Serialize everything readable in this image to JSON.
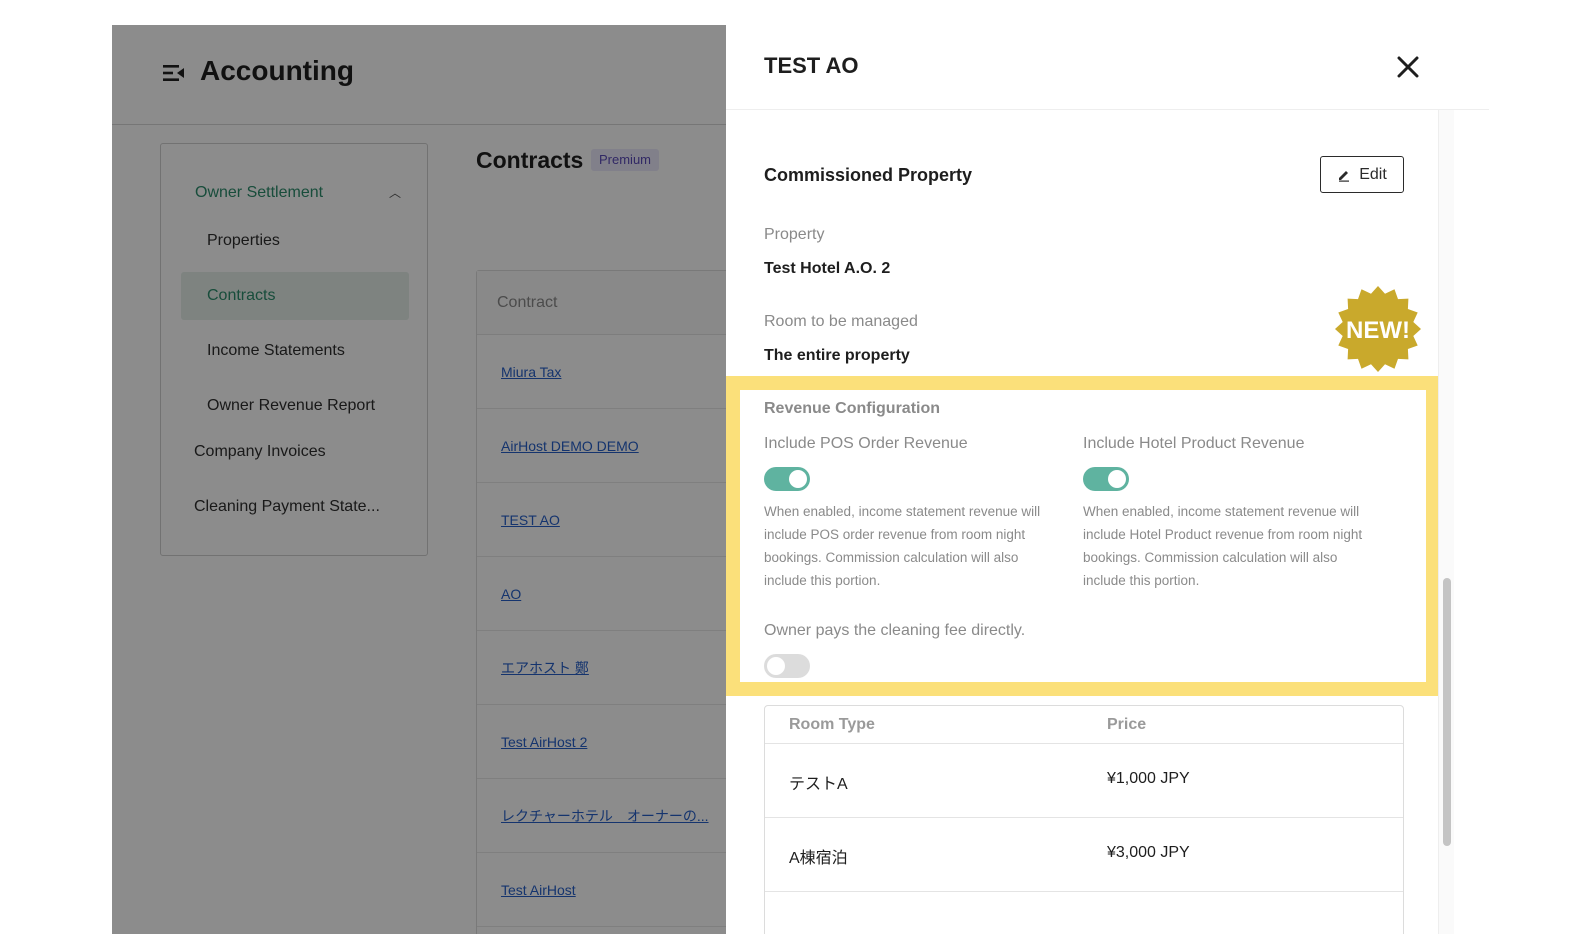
{
  "app": {
    "title": "Accounting",
    "sidebar": {
      "group_label": "Owner Settlement",
      "items": [
        "Properties",
        "Contracts",
        "Income Statements",
        "Owner Revenue Report"
      ],
      "extra_items": [
        "Company Invoices",
        "Cleaning Payment State..."
      ]
    },
    "contracts_title": "Contracts",
    "premium_badge": "Premium",
    "table_header": "Contract",
    "contracts": [
      "Miura Tax",
      "AirHost DEMO DEMO",
      "TEST AO",
      "AO",
      "エアホスト 鄭",
      "Test AirHost 2",
      "レクチャーホテル　オーナーの...",
      "Test AirHost"
    ]
  },
  "drawer": {
    "title": "TEST AO",
    "section_title": "Commissioned Property",
    "edit_label": "Edit",
    "property_label": "Property",
    "property_value": "Test Hotel A.O. 2",
    "room_label": "Room to be managed",
    "room_value": "The entire property",
    "new_badge": "NEW!",
    "revenue": {
      "title": "Revenue Configuration",
      "pos_label": "Include POS Order Revenue",
      "pos_enabled": true,
      "pos_desc": "When enabled, income statement revenue will include POS order revenue from room night bookings. Commission calculation will also include this portion.",
      "hotel_label": "Include Hotel Product Revenue",
      "hotel_enabled": true,
      "hotel_desc": "When enabled, income statement revenue will include Hotel Product revenue from room night bookings. Commission calculation will also include this portion.",
      "cleaning_label": "Owner pays the cleaning fee directly.",
      "cleaning_enabled": false
    },
    "room_table": {
      "col_room_type": "Room Type",
      "col_price": "Price",
      "rows": [
        {
          "room_type": "テストA",
          "price": "¥1,000 JPY"
        },
        {
          "room_type": "A棟宿泊",
          "price": "¥3,000 JPY"
        }
      ]
    }
  },
  "colors": {
    "accent_green": "#5fb3a0",
    "nav_green": "#2c8c6c",
    "highlight_yellow": "#fbe07a",
    "badge_gold": "#c9a92c"
  }
}
